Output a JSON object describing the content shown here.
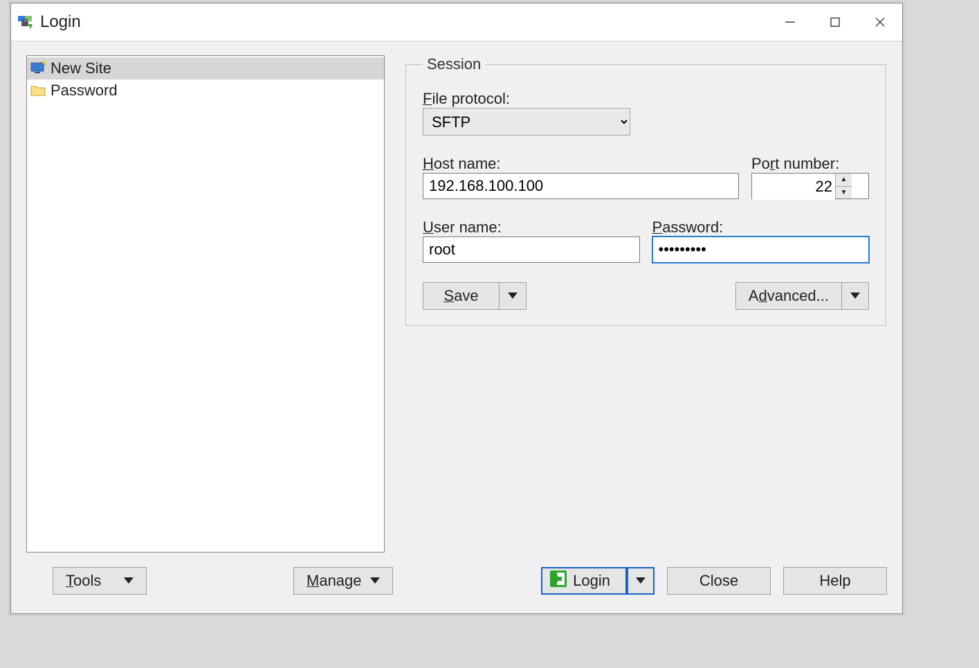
{
  "window": {
    "title": "Login"
  },
  "sites": {
    "items": [
      {
        "label": "New Site",
        "icon": "monitor-new",
        "selected": true
      },
      {
        "label": "Password",
        "icon": "folder",
        "selected": false
      }
    ]
  },
  "session": {
    "legend": "Session",
    "protocol_label_pre": "F",
    "protocol_label_post": "ile protocol:",
    "protocol_value": "SFTP",
    "host_label_pre": "H",
    "host_label_post": "ost name:",
    "host_value": "192.168.100.100",
    "port_label_pre": "Po",
    "port_label_u": "r",
    "port_label_post": "t number:",
    "port_value": "22",
    "user_label_pre": "U",
    "user_label_post": "ser name:",
    "user_value": "root",
    "pass_label_pre": "P",
    "pass_label_post": "assword:",
    "pass_value": "•••••••••",
    "save_pre": "S",
    "save_post": "ave",
    "advanced_pre": "A",
    "advanced_u": "d",
    "advanced_post": "vanced..."
  },
  "footer": {
    "tools_pre": "T",
    "tools_post": "ools",
    "manage_pre": "M",
    "manage_post": "anage",
    "login": "Login",
    "close": "Close",
    "help": "Help"
  }
}
